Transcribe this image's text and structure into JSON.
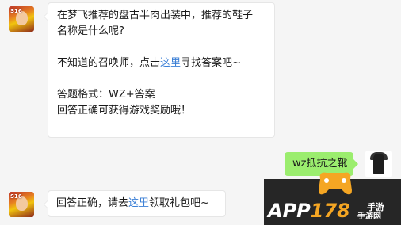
{
  "messages": {
    "question": {
      "line1": "在梦飞推荐的盘古半肉出装中，推荐的鞋子",
      "line2": "名称是什么呢?",
      "hint_prefix": "不知道的召唤师，点击",
      "hint_link": "这里",
      "hint_suffix": "寻找答案吧~",
      "format_line": "答题格式：WZ+答案",
      "reward_line": "回答正确可获得游戏奖励哦！"
    },
    "reply": {
      "text": "wz抵抗之靴"
    },
    "answer": {
      "prefix": "回答正确，请去",
      "link": "这里",
      "suffix": "领取礼包吧~"
    }
  },
  "avatars": {
    "bot_badge": "S16"
  },
  "watermark": {
    "app_text": "APP",
    "num_text": "178",
    "cn_short": "手游",
    "cn_site": "手游网"
  },
  "colors": {
    "link": "#3b7fd6",
    "reply_bubble": "#9bed6e",
    "page_bg": "#f5f5f5"
  }
}
